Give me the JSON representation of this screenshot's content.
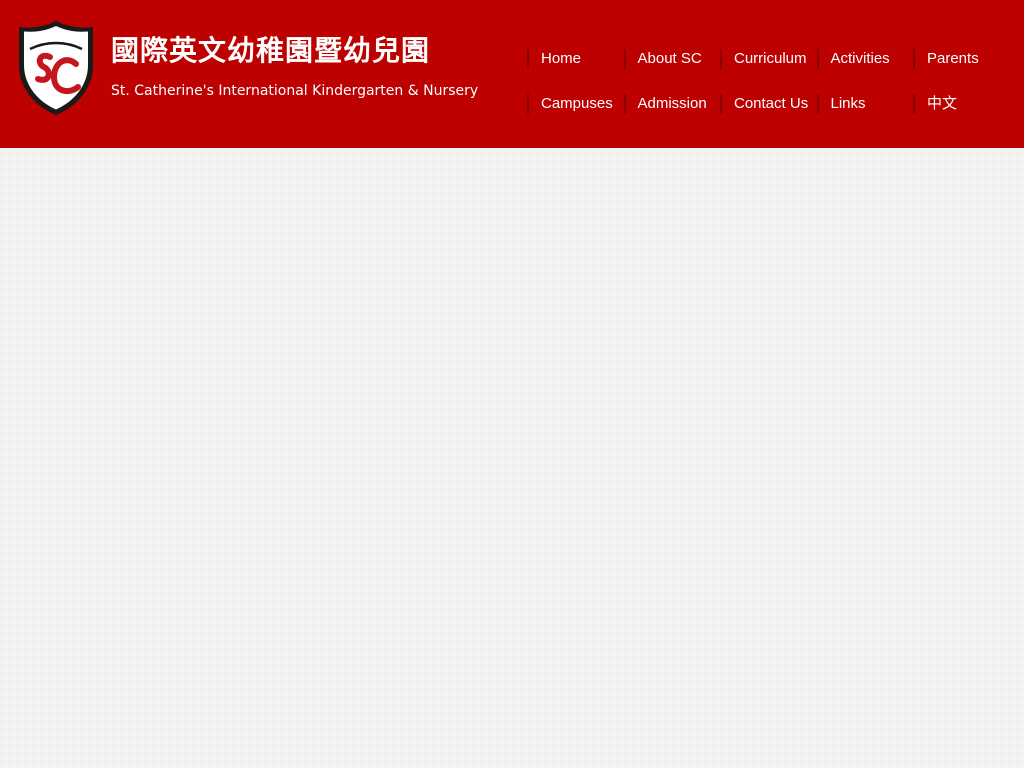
{
  "header": {
    "title_zh": "國際英文幼稚園暨幼兒園",
    "title_en": "St. Catherine's International Kindergarten & Nursery",
    "crest_monogram": "SC",
    "brand_color": "#bd0000",
    "crest_red": "#c4161c"
  },
  "nav": {
    "items": [
      {
        "label": "Home"
      },
      {
        "label": "About SC"
      },
      {
        "label": "Curriculum"
      },
      {
        "label": "Activities"
      },
      {
        "label": "Parents"
      },
      {
        "label": "Campuses"
      },
      {
        "label": "Admission"
      },
      {
        "label": "Contact Us"
      },
      {
        "label": "Links"
      },
      {
        "label": "中文"
      }
    ]
  }
}
